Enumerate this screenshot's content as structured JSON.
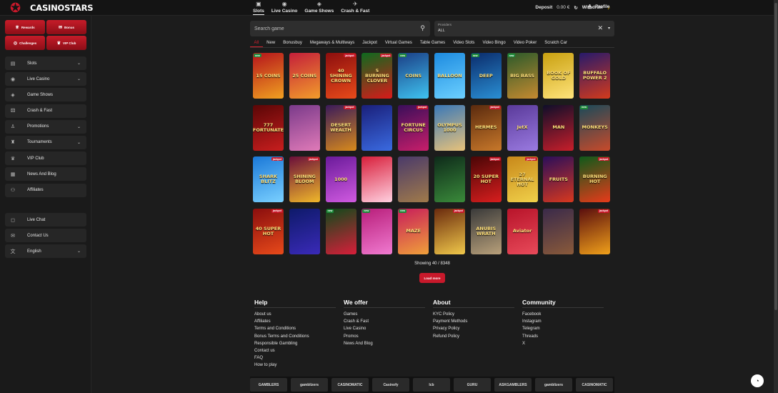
{
  "header": {
    "logo_text": "CASINOSTARS",
    "nav": [
      {
        "label": "Slots",
        "icon": "slots-icon",
        "glyph": "▣"
      },
      {
        "label": "Live Casino",
        "icon": "live-casino-icon",
        "glyph": "◉"
      },
      {
        "label": "Game Shows",
        "icon": "game-shows-icon",
        "glyph": "◈"
      },
      {
        "label": "Crash & Fast",
        "icon": "crash-icon",
        "glyph": "✈"
      }
    ],
    "deposit_label": "Deposit",
    "deposit_value": "0.00 €",
    "withdraw_label": "Withdraw",
    "profile_label": "Profile"
  },
  "sidebar": {
    "promos": [
      {
        "label": "Rewards",
        "icon": "rewards-icon",
        "glyph": "♕"
      },
      {
        "label": "Bonus",
        "icon": "gift-icon",
        "glyph": "✉"
      },
      {
        "label": "Challenges",
        "icon": "challenge-icon",
        "glyph": "◎"
      },
      {
        "label": "VIP Club",
        "icon": "crown-icon",
        "glyph": "♛"
      }
    ],
    "items": [
      {
        "label": "Slots",
        "icon": "slots-icon",
        "glyph": "▤",
        "expandable": true
      },
      {
        "label": "Live Casino",
        "icon": "live-casino-icon",
        "glyph": "◉",
        "expandable": true
      },
      {
        "label": "Game Shows",
        "icon": "game-shows-icon",
        "glyph": "◈",
        "expandable": false
      },
      {
        "label": "Crash & Fast",
        "icon": "crash-icon",
        "glyph": "⚄",
        "expandable": false
      },
      {
        "label": "Promotions",
        "icon": "promotions-icon",
        "glyph": "♙",
        "expandable": true
      },
      {
        "label": "Tournaments",
        "icon": "tournaments-icon",
        "glyph": "♜",
        "expandable": true
      },
      {
        "label": "VIP Club",
        "icon": "crown-icon",
        "glyph": "♛",
        "expandable": false
      },
      {
        "label": "News And Blog",
        "icon": "news-icon",
        "glyph": "▦",
        "expandable": false
      },
      {
        "label": "Affiliates",
        "icon": "affiliates-icon",
        "glyph": "⚇",
        "expandable": false
      }
    ],
    "items2": [
      {
        "label": "Live Chat",
        "icon": "chat-icon",
        "glyph": "◻",
        "expandable": false
      },
      {
        "label": "Contact Us",
        "icon": "mail-icon",
        "glyph": "✉",
        "expandable": false
      },
      {
        "label": "English",
        "icon": "language-icon",
        "glyph": "文",
        "expandable": true
      }
    ]
  },
  "search": {
    "placeholder": "Search game"
  },
  "providers": {
    "label": "Providers",
    "value": "ALL"
  },
  "tabs": [
    "All",
    "New",
    "Bonusbuy",
    "Megaways & Multiways",
    "Jackpot",
    "Virtual Games",
    "Table Games",
    "Video Slots",
    "Video Bingo",
    "Video Poker",
    "Scratch Car"
  ],
  "games": [
    {
      "title": "15 COINS",
      "badge": "new",
      "bg": "#b5141c",
      "bg2": "#f0a020"
    },
    {
      "title": "25 COINS",
      "badge": "",
      "bg": "#c41f3a",
      "bg2": "#f29c2b"
    },
    {
      "title": "40 SHINING CROWN",
      "badge": "jackpot",
      "bg": "#8c0e0e",
      "bg2": "#e84a1a"
    },
    {
      "title": "5 BURNING CLOVER",
      "badge": "jackpot",
      "bg": "#0d6a1e",
      "bg2": "#d91a1a"
    },
    {
      "title": "COINS",
      "badge": "new",
      "bg": "#1b3f86",
      "bg2": "#3fc3f0"
    },
    {
      "title": "BALLOON",
      "badge": "",
      "bg": "#1d8be0",
      "bg2": "#6cd0ff"
    },
    {
      "title": "DEEP",
      "badge": "new",
      "bg": "#0b2c6b",
      "bg2": "#2a8fd4"
    },
    {
      "title": "BIG BASS",
      "badge": "new",
      "bg": "#2c5a2a",
      "bg2": "#c58a30"
    },
    {
      "title": "BOOK OF GOLD",
      "badge": "",
      "bg": "#c9a010",
      "bg2": "#ffe37a"
    },
    {
      "title": "BUFFALO POWER 2",
      "badge": "",
      "bg": "#271a6b",
      "bg2": "#d43a1c"
    },
    {
      "title": "777 FORTUNATE",
      "badge": "",
      "bg": "#5a0606",
      "bg2": "#c81e1e"
    },
    {
      "title": "",
      "badge": "",
      "bg": "#7a3a8a",
      "bg2": "#e07ab8"
    },
    {
      "title": "DESERT WEALTH",
      "badge": "jackpot",
      "bg": "#3a1a5a",
      "bg2": "#d88a1c"
    },
    {
      "title": "",
      "badge": "",
      "bg": "#1a1f7a",
      "bg2": "#3a6ae0"
    },
    {
      "title": "FORTUNE CIRCUS",
      "badge": "jackpot",
      "bg": "#3a0e5a",
      "bg2": "#c81e6a"
    },
    {
      "title": "OLYMPUS 1000",
      "badge": "",
      "bg": "#3a78b8",
      "bg2": "#e8c27a"
    },
    {
      "title": "HERMES",
      "badge": "jackpot",
      "bg": "#5a2a0e",
      "bg2": "#c8782a"
    },
    {
      "title": "JetX",
      "badge": "",
      "bg": "#5a3a9a",
      "bg2": "#9a7ae0"
    },
    {
      "title": "MAN",
      "badge": "",
      "bg": "#0e0e2a",
      "bg2": "#c81e2a"
    },
    {
      "title": "MONKEYS",
      "badge": "new",
      "bg": "#1a4a5a",
      "bg2": "#c84a2a"
    },
    {
      "title": "SHARK BLITZ",
      "badge": "jackpot",
      "bg": "#1a78d8",
      "bg2": "#7ad0ff"
    },
    {
      "title": "SHINING BLOOM",
      "badge": "jackpot",
      "bg": "#6a0e3a",
      "bg2": "#f0b82a"
    },
    {
      "title": "1000",
      "badge": "",
      "bg": "#6a1a9a",
      "bg2": "#d05ae0"
    },
    {
      "title": "",
      "badge": "",
      "bg": "#d81e3a",
      "bg2": "#ffd0e0"
    },
    {
      "title": "",
      "badge": "",
      "bg": "#4a3a6a",
      "bg2": "#a07a4a"
    },
    {
      "title": "",
      "badge": "",
      "bg": "#0e2a1a",
      "bg2": "#3a8a3a"
    },
    {
      "title": "20 SUPER HOT",
      "badge": "jackpot",
      "bg": "#4a0606",
      "bg2": "#d81e1e"
    },
    {
      "title": "27 ETERNAL HOT",
      "badge": "jackpot",
      "bg": "#c8881a",
      "bg2": "#f0d04a"
    },
    {
      "title": "FRUITS",
      "badge": "",
      "bg": "#2a0e5a",
      "bg2": "#d8381e"
    },
    {
      "title": "BURNING HOT",
      "badge": "jackpot",
      "bg": "#0e5a1a",
      "bg2": "#e83a1a"
    },
    {
      "title": "40 SUPER HOT",
      "badge": "jackpot",
      "bg": "#8a0e0e",
      "bg2": "#e84a1a"
    },
    {
      "title": "",
      "badge": "",
      "bg": "#0e1a6a",
      "bg2": "#3a2ab8"
    },
    {
      "title": "",
      "badge": "new",
      "bg": "#0e4a1a",
      "bg2": "#d81e3a"
    },
    {
      "title": "",
      "badge": "new",
      "bg": "#b81e7a",
      "bg2": "#f07ad0"
    },
    {
      "title": "MAZE",
      "badge": "new",
      "bg": "#c81e5a",
      "bg2": "#f0a03a"
    },
    {
      "title": "",
      "badge": "jackpot",
      "bg": "#6a2a0e",
      "bg2": "#f0c84a"
    },
    {
      "title": "ANUBIS WRATH",
      "badge": "",
      "bg": "#3a3a3a",
      "bg2": "#b8a07a"
    },
    {
      "title": "Aviator",
      "badge": "",
      "bg": "#b8142a",
      "bg2": "#e84a5a"
    },
    {
      "title": "",
      "badge": "",
      "bg": "#3a2a4a",
      "bg2": "#8a5a3a"
    },
    {
      "title": "",
      "badge": "jackpot",
      "bg": "#5a0e0e",
      "bg2": "#f0a01a"
    }
  ],
  "showing_text": "Showing 40 / 8348",
  "load_more_label": "Load more",
  "footer": {
    "columns": [
      {
        "title": "Help",
        "links": [
          "About us",
          "Affiliates",
          "Terms and Conditions",
          "Bonus Terms and Conditions",
          "Responsible Gambling",
          "Contact us",
          "FAQ",
          "How to play"
        ]
      },
      {
        "title": "We offer",
        "links": [
          "Games",
          "Crash & Fast",
          "Live Casino",
          "Promos",
          "News And Blog"
        ]
      },
      {
        "title": "About",
        "links": [
          "KYC Policy",
          "Payment Methods",
          "Privacy Policy",
          "Refund Policy"
        ]
      },
      {
        "title": "Community",
        "links": [
          "Facebook",
          "Instagram",
          "Telegram",
          "Threads",
          "X"
        ]
      }
    ]
  },
  "partners": [
    "GAMBLERS",
    "gamblizers",
    "CASINOMATIC",
    "Casinofy",
    "lcb",
    "GURU",
    "ASKGAMBLERS",
    "gamblizers",
    "CASINOMATIC",
    "C"
  ],
  "colors": {
    "accent": "#c8192b",
    "bg": "#1c1c1c",
    "panel": "#262626"
  }
}
